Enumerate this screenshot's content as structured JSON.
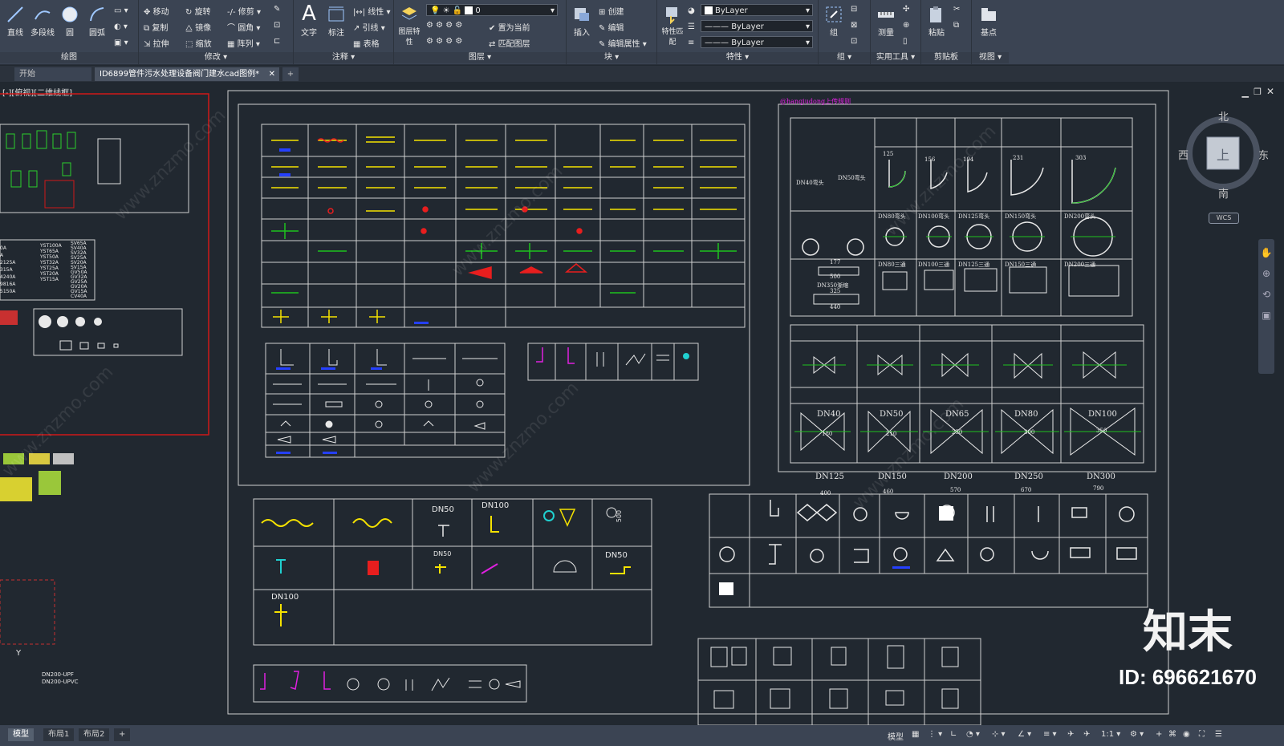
{
  "ribbon": {
    "draw": {
      "title": "绘图",
      "line": "直线",
      "polyline": "多段线",
      "circle": "圆",
      "arc": "圆弧"
    },
    "modify": {
      "title": "修改",
      "move": "移动",
      "rotate": "旋转",
      "trim": "修剪",
      "copy": "复制",
      "mirror": "镜像",
      "fillet": "圆角",
      "stretch": "拉伸",
      "scale": "缩放",
      "array": "阵列"
    },
    "annotate": {
      "title": "注释",
      "text": "文字",
      "dimension": "标注",
      "linear": "线性",
      "leader": "引线",
      "table": "表格"
    },
    "layers": {
      "title": "图层",
      "props": "图层特性",
      "layer_value": "0",
      "set_current": "置为当前",
      "match_layer": "匹配图层"
    },
    "block": {
      "title": "块",
      "insert": "插入",
      "create": "创建",
      "edit": "编辑",
      "edit_attr": "编辑属性"
    },
    "properties": {
      "title": "特性",
      "match": "特性匹配",
      "color": "ByLayer",
      "linetype": "ByLayer",
      "lineweight": "ByLayer"
    },
    "groups": {
      "title": "组",
      "group": "组"
    },
    "utilities": {
      "title": "实用工具",
      "measure": "测量"
    },
    "clipboard": {
      "title": "剪贴板",
      "paste": "粘贴"
    },
    "view": {
      "title": "视图",
      "base": "基点"
    }
  },
  "tabs": [
    {
      "label": "开始"
    },
    {
      "label": "ID6899管件污水处理设备阀门建水cad图例*"
    }
  ],
  "viewport": {
    "label": "[-][俯视][二维线框]"
  },
  "viewcube": {
    "north": "北",
    "south": "南",
    "east": "东",
    "west": "西",
    "top": "上",
    "wcs": "WCS"
  },
  "sheet_right": {
    "author": "@hanqiudong上传规则",
    "top_labels": [
      "DN40弯头",
      "DN50弯头",
      "DN80弯头",
      "DN100弯头",
      "DN125弯头",
      "DN150弯头",
      "DN200弯头",
      "DN80三通",
      "DN100三通",
      "DN125三通",
      "DN150三通",
      "DN200三通",
      "DN350渐缩"
    ],
    "elbow_dims": [
      "125",
      "156",
      "194",
      "231",
      "303"
    ],
    "valve_row1": [
      "DN40",
      "DN50",
      "DN65",
      "DN80",
      "DN100"
    ],
    "valve_row1_dims": [
      "180",
      "210",
      "250",
      "300",
      "350"
    ],
    "valve_row2": [
      "DN125",
      "DN150",
      "DN200",
      "DN250",
      "DN300"
    ],
    "valve_row2_dims": [
      "400",
      "460",
      "570",
      "670",
      "790"
    ],
    "misc_dims": [
      "177",
      "500",
      "325",
      "440"
    ]
  },
  "sheet_lower": {
    "labels": [
      "DN50",
      "DN100",
      "DN50",
      "DN50",
      "DN100",
      "500"
    ]
  },
  "left_panel": {
    "codes_a": [
      "YST100A",
      "YST65A",
      "YST50A",
      "YST32A",
      "YST25A",
      "YST20A",
      "YST15A"
    ],
    "codes_b": [
      "SV65A",
      "SV40A",
      "SV32A",
      "SV25A",
      "SV20A",
      "SV15A",
      "GV50A",
      "GV32A",
      "GV25A",
      "GV20A",
      "GV15A",
      "CV40A"
    ],
    "codes_c": [
      "0A",
      "A",
      "2125A",
      "315A",
      "4240A",
      "9816A",
      "5150A"
    ],
    "pipe_notes": [
      "DN200-UPF",
      "DN200-UPVC"
    ]
  },
  "status": {
    "layouts": [
      "模型",
      "布局1",
      "布局2"
    ],
    "model": "模型",
    "scale": "1:1"
  },
  "watermark": {
    "brand": "知末",
    "site": "www.znzmo.com",
    "id": "ID: 696621670"
  },
  "colors": {
    "ribbon_bg": "#3b4453",
    "canvas_bg": "#212830",
    "line_yellow": "#f5e200",
    "line_red": "#e81e1e",
    "line_green": "#1ec21e",
    "line_blue": "#2540ff",
    "line_magenta": "#e020e0",
    "line_cyan": "#20d0d0"
  }
}
